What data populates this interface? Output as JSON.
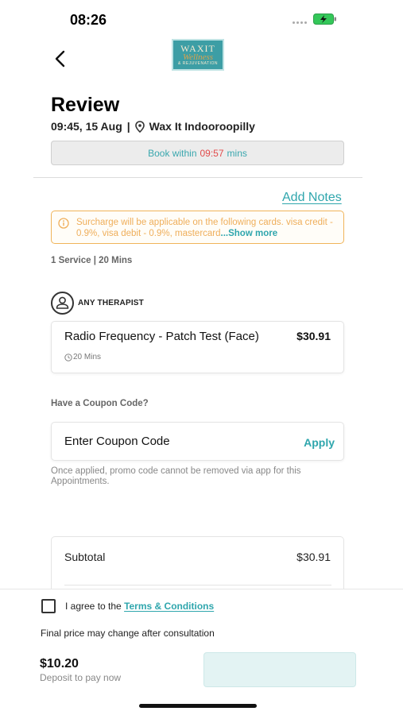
{
  "status_bar": {
    "time": "08:26"
  },
  "header": {
    "logo": {
      "line1": "WAXIT",
      "line2": "Wellness",
      "line3": "& REJUVENATION"
    }
  },
  "review": {
    "title": "Review",
    "datetime": "09:45, 15 Aug",
    "separator": "|",
    "location": "Wax It Indooroopilly",
    "book_within_prefix": "Book within",
    "book_within_time": "09:57",
    "book_within_suffix": "mins"
  },
  "add_notes": "Add Notes",
  "surcharge": {
    "text": "Surcharge will be applicable on the following cards. visa credit - 0.9%, visa debit - 0.9%, mastercard",
    "show_more": "...Show more"
  },
  "services_summary": "1 Service | 20 Mins",
  "therapist": "ANY THERAPIST",
  "service": {
    "name": "Radio Frequency - Patch Test (Face)",
    "price": "$30.91",
    "duration": "20 Mins"
  },
  "coupon": {
    "question": "Have a Coupon Code?",
    "placeholder": "Enter Coupon Code",
    "apply_label": "Apply",
    "note": "Once applied, promo code cannot be removed via app for this Appointments."
  },
  "summary": {
    "subtotal_label": "Subtotal",
    "subtotal_value": "$30.91"
  },
  "footer": {
    "agree_prefix": "I agree to the",
    "terms_link": "Terms & Conditions",
    "final_note": "Final price may change after consultation",
    "deposit_amount": "$10.20",
    "deposit_label": "Deposit to pay now"
  },
  "colors": {
    "accent": "#2fa6ad",
    "warning": "#efae5a",
    "timer": "#e24b4b"
  }
}
